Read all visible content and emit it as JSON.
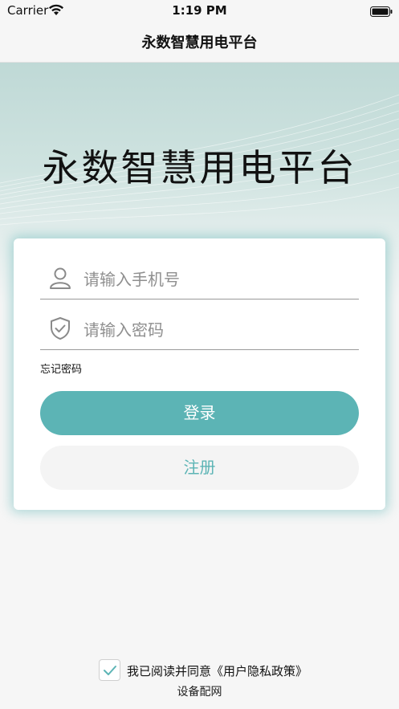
{
  "status_bar": {
    "carrier": "Carrier",
    "time": "1:19 PM"
  },
  "nav": {
    "title": "永数智慧用电平台"
  },
  "hero": {
    "title": "永数智慧用电平台"
  },
  "login_form": {
    "phone_placeholder": "请输入手机号",
    "password_placeholder": "请输入密码",
    "forgot_password": "忘记密码",
    "login_button": "登录",
    "register_button": "注册"
  },
  "footer": {
    "agreement_text": "我已阅读并同意《用户隐私政策》",
    "agreement_checked": true,
    "config_network": "设备配网"
  },
  "colors": {
    "accent": "#5cb4b5",
    "background": "#f6f6f6",
    "hero_gradient_top": "#bfd9d6"
  },
  "icons": {
    "phone_field": "user-icon",
    "password_field": "shield-check-icon",
    "checkbox": "checkmark-icon"
  }
}
